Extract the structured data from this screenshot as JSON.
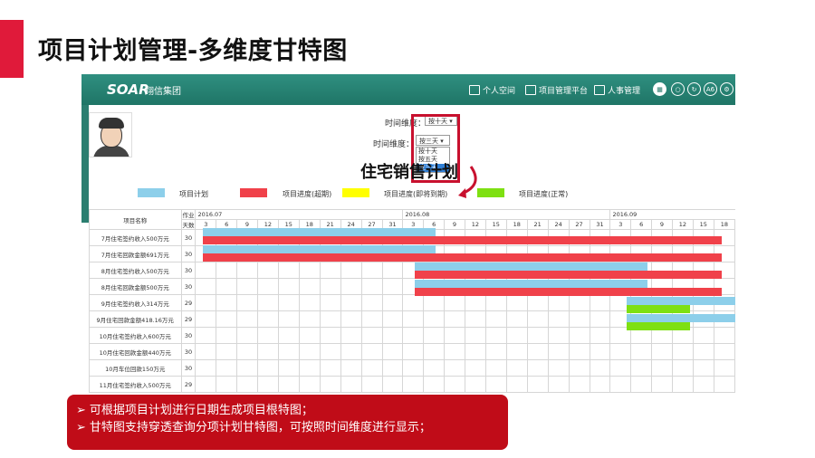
{
  "slide": {
    "title": "项目计划管理-多维度甘特图",
    "accent_color": "#e01a3a"
  },
  "app": {
    "logo": "SOAR",
    "logo_sub": "翔信集团",
    "nav": [
      {
        "label": "个人空间",
        "icon": "home-icon"
      },
      {
        "label": "项目管理平台",
        "icon": "building-icon"
      },
      {
        "label": "人事管理",
        "icon": "org-icon"
      }
    ],
    "toolbar_icons": [
      "apps-icon",
      "search-icon",
      "refresh-icon",
      "font-size-icon",
      "settings-icon"
    ],
    "font_btn_label": "A6"
  },
  "time_dimension": {
    "label_top": "时间维度：",
    "value_top": "按十天",
    "label_bottom": "时间维度：",
    "value_bottom": "按三天",
    "options": [
      "按十天",
      "按五天",
      "按三天"
    ],
    "selected_option": "按三天"
  },
  "plan_title": "住宅销售计划",
  "legend": [
    {
      "label": "项目计划",
      "color": "#8dcfea"
    },
    {
      "label": "项目进度(超期)",
      "color": "#f0414a"
    },
    {
      "label": "项目进度(即将到期)",
      "color": "#ffff00"
    },
    {
      "label": "项目进度(正常)",
      "color": "#7ee012"
    }
  ],
  "table": {
    "col_name": "项目名称",
    "col_days_line1": "作业",
    "col_days_line2": "天数",
    "months": [
      {
        "label": "2016.07",
        "span": 10
      },
      {
        "label": "2016.08",
        "span": 10
      },
      {
        "label": "2016.09",
        "span": 6
      }
    ],
    "days": [
      "3",
      "6",
      "9",
      "12",
      "15",
      "18",
      "21",
      "24",
      "27",
      "31",
      "3",
      "6",
      "9",
      "12",
      "15",
      "18",
      "21",
      "24",
      "27",
      "31",
      "3",
      "6",
      "9",
      "12",
      "15",
      "18"
    ],
    "rows": [
      {
        "name": "7月住宅签约收入500万元",
        "days": "30",
        "bars": [
          {
            "type": "plan",
            "start": 0,
            "end": 11
          },
          {
            "type": "overdue",
            "start": 0,
            "end": 24.5,
            "lane": 1
          }
        ]
      },
      {
        "name": "7月住宅回款金额691万元",
        "days": "30",
        "bars": [
          {
            "type": "plan",
            "start": 0,
            "end": 11
          },
          {
            "type": "overdue",
            "start": 0,
            "end": 24.5,
            "lane": 1
          }
        ]
      },
      {
        "name": "8月住宅签约收入500万元",
        "days": "30",
        "bars": [
          {
            "type": "plan",
            "start": 10,
            "end": 21
          },
          {
            "type": "overdue",
            "start": 10,
            "end": 24.5,
            "lane": 1
          }
        ]
      },
      {
        "name": "8月住宅回款金额500万元",
        "days": "30",
        "bars": [
          {
            "type": "plan",
            "start": 10,
            "end": 21
          },
          {
            "type": "overdue",
            "start": 10,
            "end": 24.5,
            "lane": 1
          }
        ]
      },
      {
        "name": "9月住宅签约收入314万元",
        "days": "29",
        "bars": [
          {
            "type": "plan",
            "start": 20,
            "end": 26.2
          },
          {
            "type": "normal",
            "start": 20,
            "end": 23,
            "lane": 1
          }
        ]
      },
      {
        "name": "9月住宅回款金额418.16万元",
        "days": "29",
        "bars": [
          {
            "type": "plan",
            "start": 20,
            "end": 26.2
          },
          {
            "type": "normal",
            "start": 20,
            "end": 23,
            "lane": 1
          }
        ]
      },
      {
        "name": "10月住宅签约收入600万元",
        "days": "30",
        "bars": []
      },
      {
        "name": "10月住宅回款金额440万元",
        "days": "30",
        "bars": []
      },
      {
        "name": "10月车位回款150万元",
        "days": "30",
        "bars": []
      },
      {
        "name": "11月住宅签约收入500万元",
        "days": "29",
        "bars": []
      }
    ]
  },
  "callout": {
    "bg_color": "#c00c18",
    "lines": [
      "可根据项目计划进行日期生成项目根特图；",
      "甘特图支持穿透查询分项计划甘特图，可按照时间维度进行显示；"
    ]
  }
}
